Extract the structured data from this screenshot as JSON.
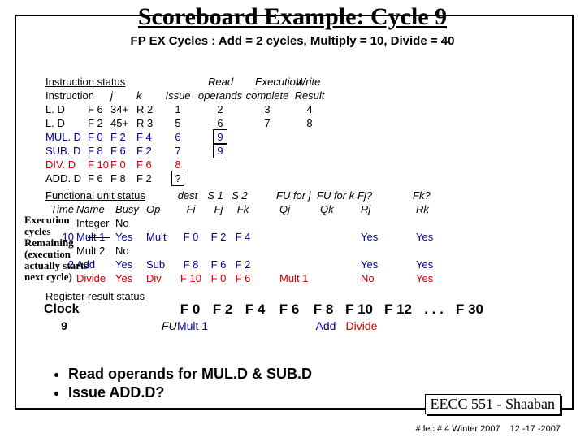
{
  "title": "Scoreboard Example:  Cycle 9",
  "subtitle": "FP EX Cycles :  Add = 2 cycles, Multiply = 10, Divide = 40",
  "instr": {
    "heading": "Instruction status",
    "cols": {
      "instr": "Instruction",
      "j": "j",
      "k": "k",
      "issue": "Issue",
      "read": "Read",
      "oper": "operands",
      "exec": "Execution",
      "comp": "complete",
      "write": "Write",
      "result": "Result"
    },
    "rows": [
      {
        "op": "L. D",
        "d": "F 6",
        "j": "34+",
        "k": "R 2",
        "issue": "1",
        "read": "2",
        "exec": "3",
        "write": "4",
        "cls": ""
      },
      {
        "op": "L. D",
        "d": "F 2",
        "j": "45+",
        "k": "R 3",
        "issue": "5",
        "read": "6",
        "exec": "7",
        "write": "8",
        "cls": ""
      },
      {
        "op": "MUL. D",
        "d": "F 0",
        "j": "F 2",
        "k": "F 4",
        "issue": "6",
        "read": "9",
        "exec": "",
        "write": "",
        "cls": "blue"
      },
      {
        "op": "SUB. D",
        "d": "F 8",
        "j": "F 6",
        "k": "F 2",
        "issue": "7",
        "read": "9",
        "exec": "",
        "write": "",
        "cls": "blue"
      },
      {
        "op": "DIV. D",
        "d": "F 10",
        "j": "F 0",
        "k": "F 6",
        "issue": "8",
        "read": "",
        "exec": "",
        "write": "",
        "cls": "red"
      },
      {
        "op": "ADD. D",
        "d": "F 6",
        "j": "F 8",
        "k": "F 2",
        "issue": "?",
        "read": "",
        "exec": "",
        "write": "",
        "cls": ""
      }
    ]
  },
  "fus": {
    "heading": "Functional unit status",
    "lbl": {
      "time": "Time",
      "name": "Name",
      "busy": "Busy",
      "op": "Op",
      "dest": "dest",
      "fi": "Fi",
      "s1": "S 1",
      "fj": "Fj",
      "s2": "S 2",
      "fk": "Fk",
      "fuj": "FU for j",
      "qj": "Qj",
      "fuk": "FU for k",
      "qk": "Qk",
      "rj": "Fj?",
      "rjl": "Rj",
      "rk": "Fk?",
      "rkl": "Rk"
    },
    "rows": [
      {
        "name": "Integer",
        "busy": "No",
        "op": "",
        "fi": "",
        "fj": "",
        "fk": "",
        "qj": "",
        "qk": "",
        "rj": "",
        "rk": ""
      },
      {
        "time": "10",
        "name": "Mult 1",
        "busy": "Yes",
        "op": "Mult",
        "fi": "F 0",
        "fj": "F 2",
        "fk": "F 4",
        "qj": "",
        "qk": "",
        "rj": "Yes",
        "rk": "Yes",
        "cls": "blue"
      },
      {
        "name": "Mult 2",
        "busy": "No",
        "op": "",
        "fi": "",
        "fj": "",
        "fk": "",
        "qj": "",
        "qk": "",
        "rj": "",
        "rk": ""
      },
      {
        "time": "2",
        "name": "Add",
        "busy": "Yes",
        "op": "Sub",
        "fi": "F 8",
        "fj": "F 6",
        "fk": "F 2",
        "qj": "",
        "qk": "",
        "rj": "Yes",
        "rk": "Yes",
        "cls": "blue"
      },
      {
        "name": "Divide",
        "busy": "Yes",
        "op": "Div",
        "fi": "F 10",
        "fj": "F 0",
        "fk": "F 6",
        "qj": "Mult 1",
        "qk": "",
        "rj": "No",
        "rk": "Yes",
        "cls": "red"
      }
    ]
  },
  "exec_note": {
    "l1": "Execution",
    "l2": "cycles",
    "l3": "Remaining",
    "l4": "(execution",
    "l5": "actually starts",
    "l6": "next cycle)"
  },
  "reg": {
    "heading": "Register result status",
    "clock": "Clock",
    "cycle": "9",
    "fu": "FU",
    "cols": [
      "F 0",
      "F 2",
      "F 4",
      "F 6",
      "F 8",
      "F 10",
      "F 12",
      ". . .",
      "F 30"
    ],
    "vals": [
      "Mult 1",
      "",
      "",
      "",
      "Add",
      "Divide",
      "",
      "",
      ""
    ]
  },
  "bullets": {
    "b1": "Read operands for MUL.D & SUB.D",
    "b2": "Issue ADD.D?"
  },
  "footer1": "EECC 551 - Shaaban",
  "footer2a": "#  lec # 4  Winter 2007",
  "footer2b": "12 -17 -2007"
}
